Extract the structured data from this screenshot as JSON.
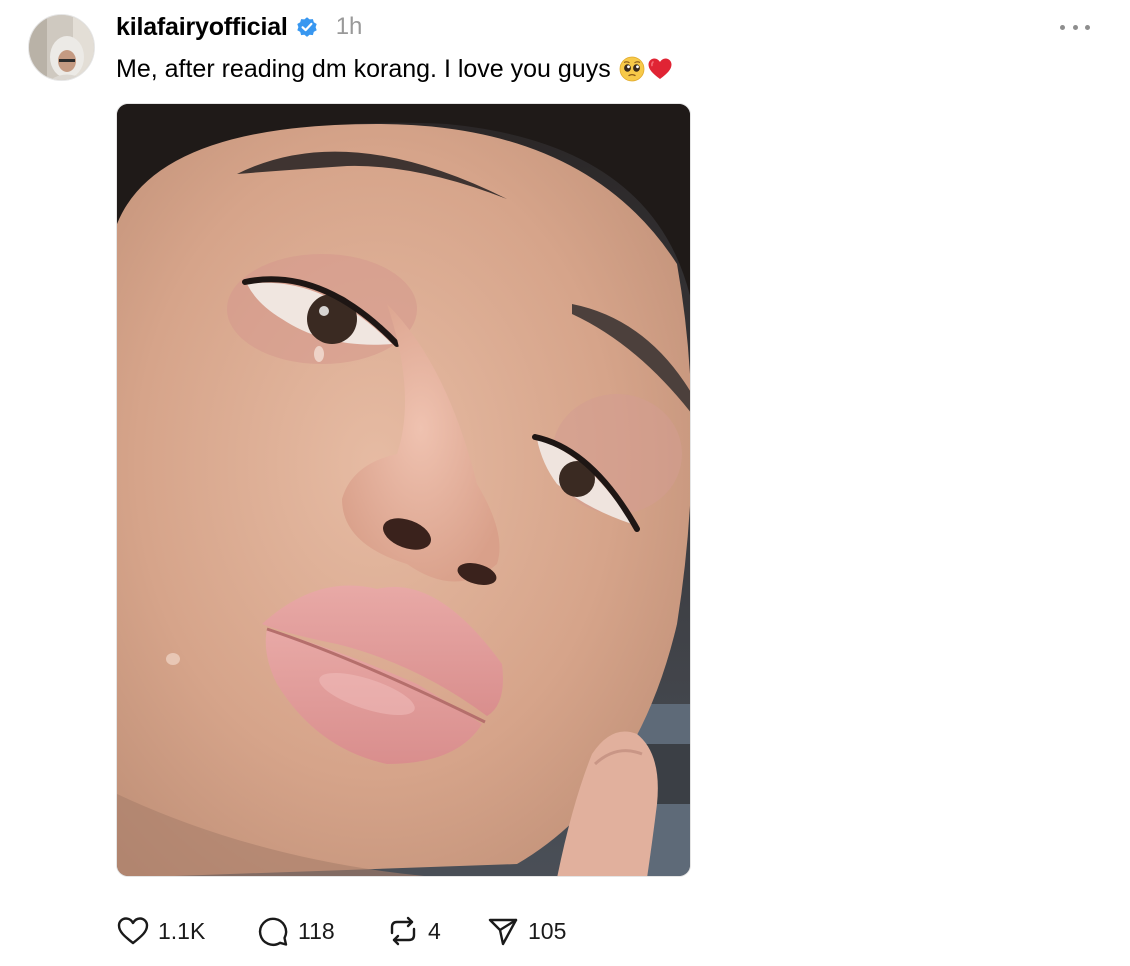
{
  "post": {
    "username": "kilafairyofficial",
    "timestamp": "1h",
    "caption": "Me, after reading dm korang. I love you guys",
    "caption_emojis": [
      "pleading-face",
      "red-heart"
    ],
    "verified": true
  },
  "actions": {
    "likes": "1.1K",
    "replies": "118",
    "reposts": "4",
    "shares": "105"
  },
  "colors": {
    "verified": "#3897f0",
    "muted": "#999999",
    "text": "#000000"
  }
}
